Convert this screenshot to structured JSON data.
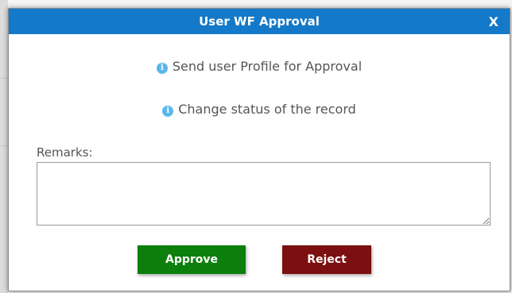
{
  "dialog": {
    "title": "User WF Approval",
    "close_label": "X",
    "info_messages": [
      {
        "icon": "info-icon",
        "text": "Send user Profile for Approval"
      },
      {
        "icon": "info-icon",
        "text": "Change status of the record"
      }
    ],
    "remarks_label": "Remarks:",
    "remarks_value": "",
    "approve_label": "Approve",
    "reject_label": "Reject"
  },
  "colors": {
    "titlebar": "#1479c8",
    "approve": "#0c7f0c",
    "reject": "#7c0f0f",
    "info_icon": "#5bb7ea"
  }
}
